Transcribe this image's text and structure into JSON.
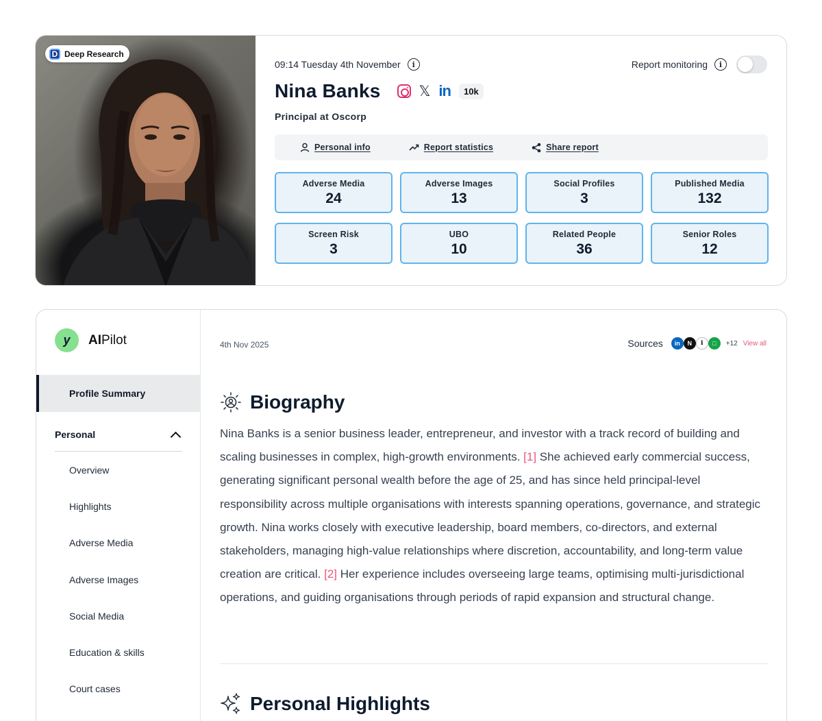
{
  "profile": {
    "badge": "Deep Research",
    "timestamp": "09:14 Tuesday 4th November",
    "monitoring_label": "Report monitoring",
    "monitoring_on": false,
    "name": "Nina Banks",
    "followers": "10k",
    "role": "Principal at Oscorp",
    "socials": [
      "instagram-icon",
      "x-icon",
      "linkedin-icon"
    ],
    "actions": [
      {
        "label": "Personal info",
        "icon": "person-icon"
      },
      {
        "label": "Report statistics",
        "icon": "trend-icon"
      },
      {
        "label": "Share report",
        "icon": "share-icon"
      }
    ],
    "stats": [
      {
        "label": "Adverse Media",
        "value": "24"
      },
      {
        "label": "Adverse Images",
        "value": "13"
      },
      {
        "label": "Social Profiles",
        "value": "3"
      },
      {
        "label": "Published Media",
        "value": "132"
      },
      {
        "label": "Screen Risk",
        "value": "3"
      },
      {
        "label": "UBO",
        "value": "10"
      },
      {
        "label": "Related People",
        "value": "36"
      },
      {
        "label": "Senior Roles",
        "value": "12"
      }
    ]
  },
  "sidebar": {
    "brand_bold": "AI",
    "brand_rest": "Pilot",
    "active_item": "Profile Summary",
    "section": "Personal",
    "items": [
      "Overview",
      "Highlights",
      "Adverse Media",
      "Adverse Images",
      "Social Media",
      "Education & skills",
      "Court cases"
    ]
  },
  "report": {
    "date": "4th Nov 2025",
    "sources_label": "Sources",
    "sources_more": "+12",
    "sources_view_all": "View all",
    "biography_title": "Biography",
    "bio_part1": "Nina Banks is a senior business leader, entrepreneur, and investor with a track record of building and scaling businesses in complex, high-growth environments. ",
    "cite1": "[1]",
    "bio_part2": " She achieved early commercial success, generating significant personal wealth before the age of 25, and has since held principal-level responsibility across multiple organisations with interests spanning operations, governance, and strategic growth. Nina works closely with executive leadership, board members, co-directors, and external stakeholders, managing high-value relationships where discretion, accountability, and long-term value creation are critical. ",
    "cite2": "[2]",
    "bio_part3": " Her experience includes overseeing large teams, optimising multi-jurisdictional operations, and guiding organisations through periods of rapid expansion and structural change.",
    "highlights_title": "Personal Highlights"
  },
  "colors": {
    "stat_border": "#5fb4ec",
    "stat_bg": "#e9f3f9",
    "citation": "#e8577a",
    "brand_green": "#86e08f"
  }
}
